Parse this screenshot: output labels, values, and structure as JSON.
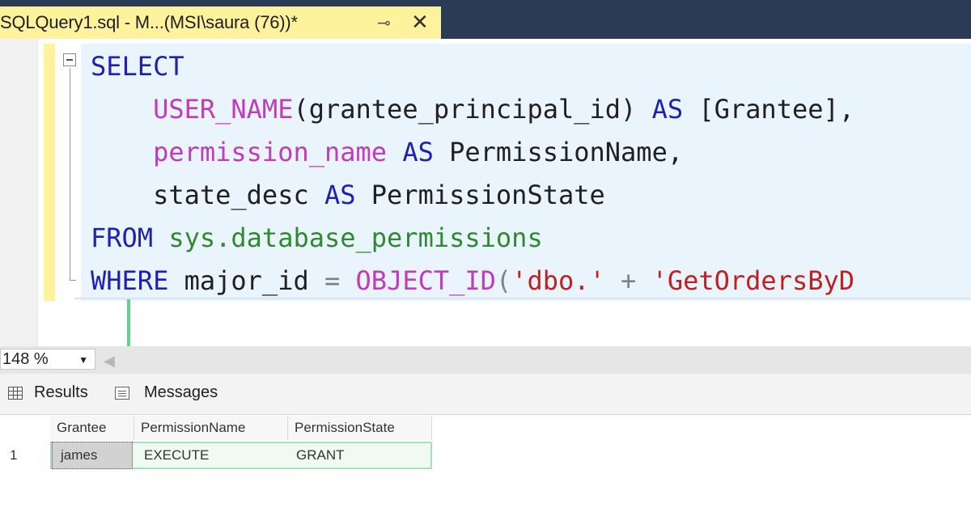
{
  "tab": {
    "title": "SQLQuery1.sql - M...(MSI\\saura (76))*",
    "pin_glyph": "⊸",
    "close_glyph": "✕"
  },
  "editor": {
    "lines": [
      [
        {
          "t": "SELECT",
          "c": "kw"
        }
      ],
      [
        {
          "t": "    ",
          "c": "id"
        },
        {
          "t": "USER_NAME",
          "c": "fn"
        },
        {
          "t": "(grantee_principal_id) ",
          "c": "id"
        },
        {
          "t": "AS",
          "c": "kw"
        },
        {
          "t": " [Grantee],",
          "c": "id"
        }
      ],
      [
        {
          "t": "    ",
          "c": "id"
        },
        {
          "t": "permission_name",
          "c": "fn"
        },
        {
          "t": " ",
          "c": "id"
        },
        {
          "t": "AS",
          "c": "kw"
        },
        {
          "t": " PermissionName,",
          "c": "id"
        }
      ],
      [
        {
          "t": "    state_desc ",
          "c": "id"
        },
        {
          "t": "AS",
          "c": "kw"
        },
        {
          "t": " PermissionState",
          "c": "id"
        }
      ],
      [
        {
          "t": "FROM",
          "c": "kw"
        },
        {
          "t": " ",
          "c": "id"
        },
        {
          "t": "sys.database_permissions",
          "c": "sys"
        }
      ],
      [
        {
          "t": "WHERE",
          "c": "kw"
        },
        {
          "t": " major_id ",
          "c": "id"
        },
        {
          "t": "=",
          "c": "op"
        },
        {
          "t": " ",
          "c": "id"
        },
        {
          "t": "OBJECT_ID",
          "c": "fn"
        },
        {
          "t": "(",
          "c": "op"
        },
        {
          "t": "'dbo.'",
          "c": "str"
        },
        {
          "t": " + ",
          "c": "op"
        },
        {
          "t": "'GetOrdersByD",
          "c": "str"
        }
      ]
    ]
  },
  "zoom": {
    "value": "148 %"
  },
  "result_tabs": {
    "results_label": "Results",
    "messages_label": "Messages"
  },
  "results": {
    "columns": [
      "Grantee",
      "PermissionName",
      "PermissionState"
    ],
    "rows": [
      {
        "num": "1",
        "cells": [
          "james",
          "EXECUTE",
          "GRANT"
        ]
      }
    ]
  },
  "colors": {
    "tab_active": "#fff29d",
    "keyword": "#1f1fb8",
    "function": "#c03bc0",
    "system_object": "#2f8a2f",
    "string": "#c02020",
    "annotation_arrow": "#5fd38a"
  }
}
